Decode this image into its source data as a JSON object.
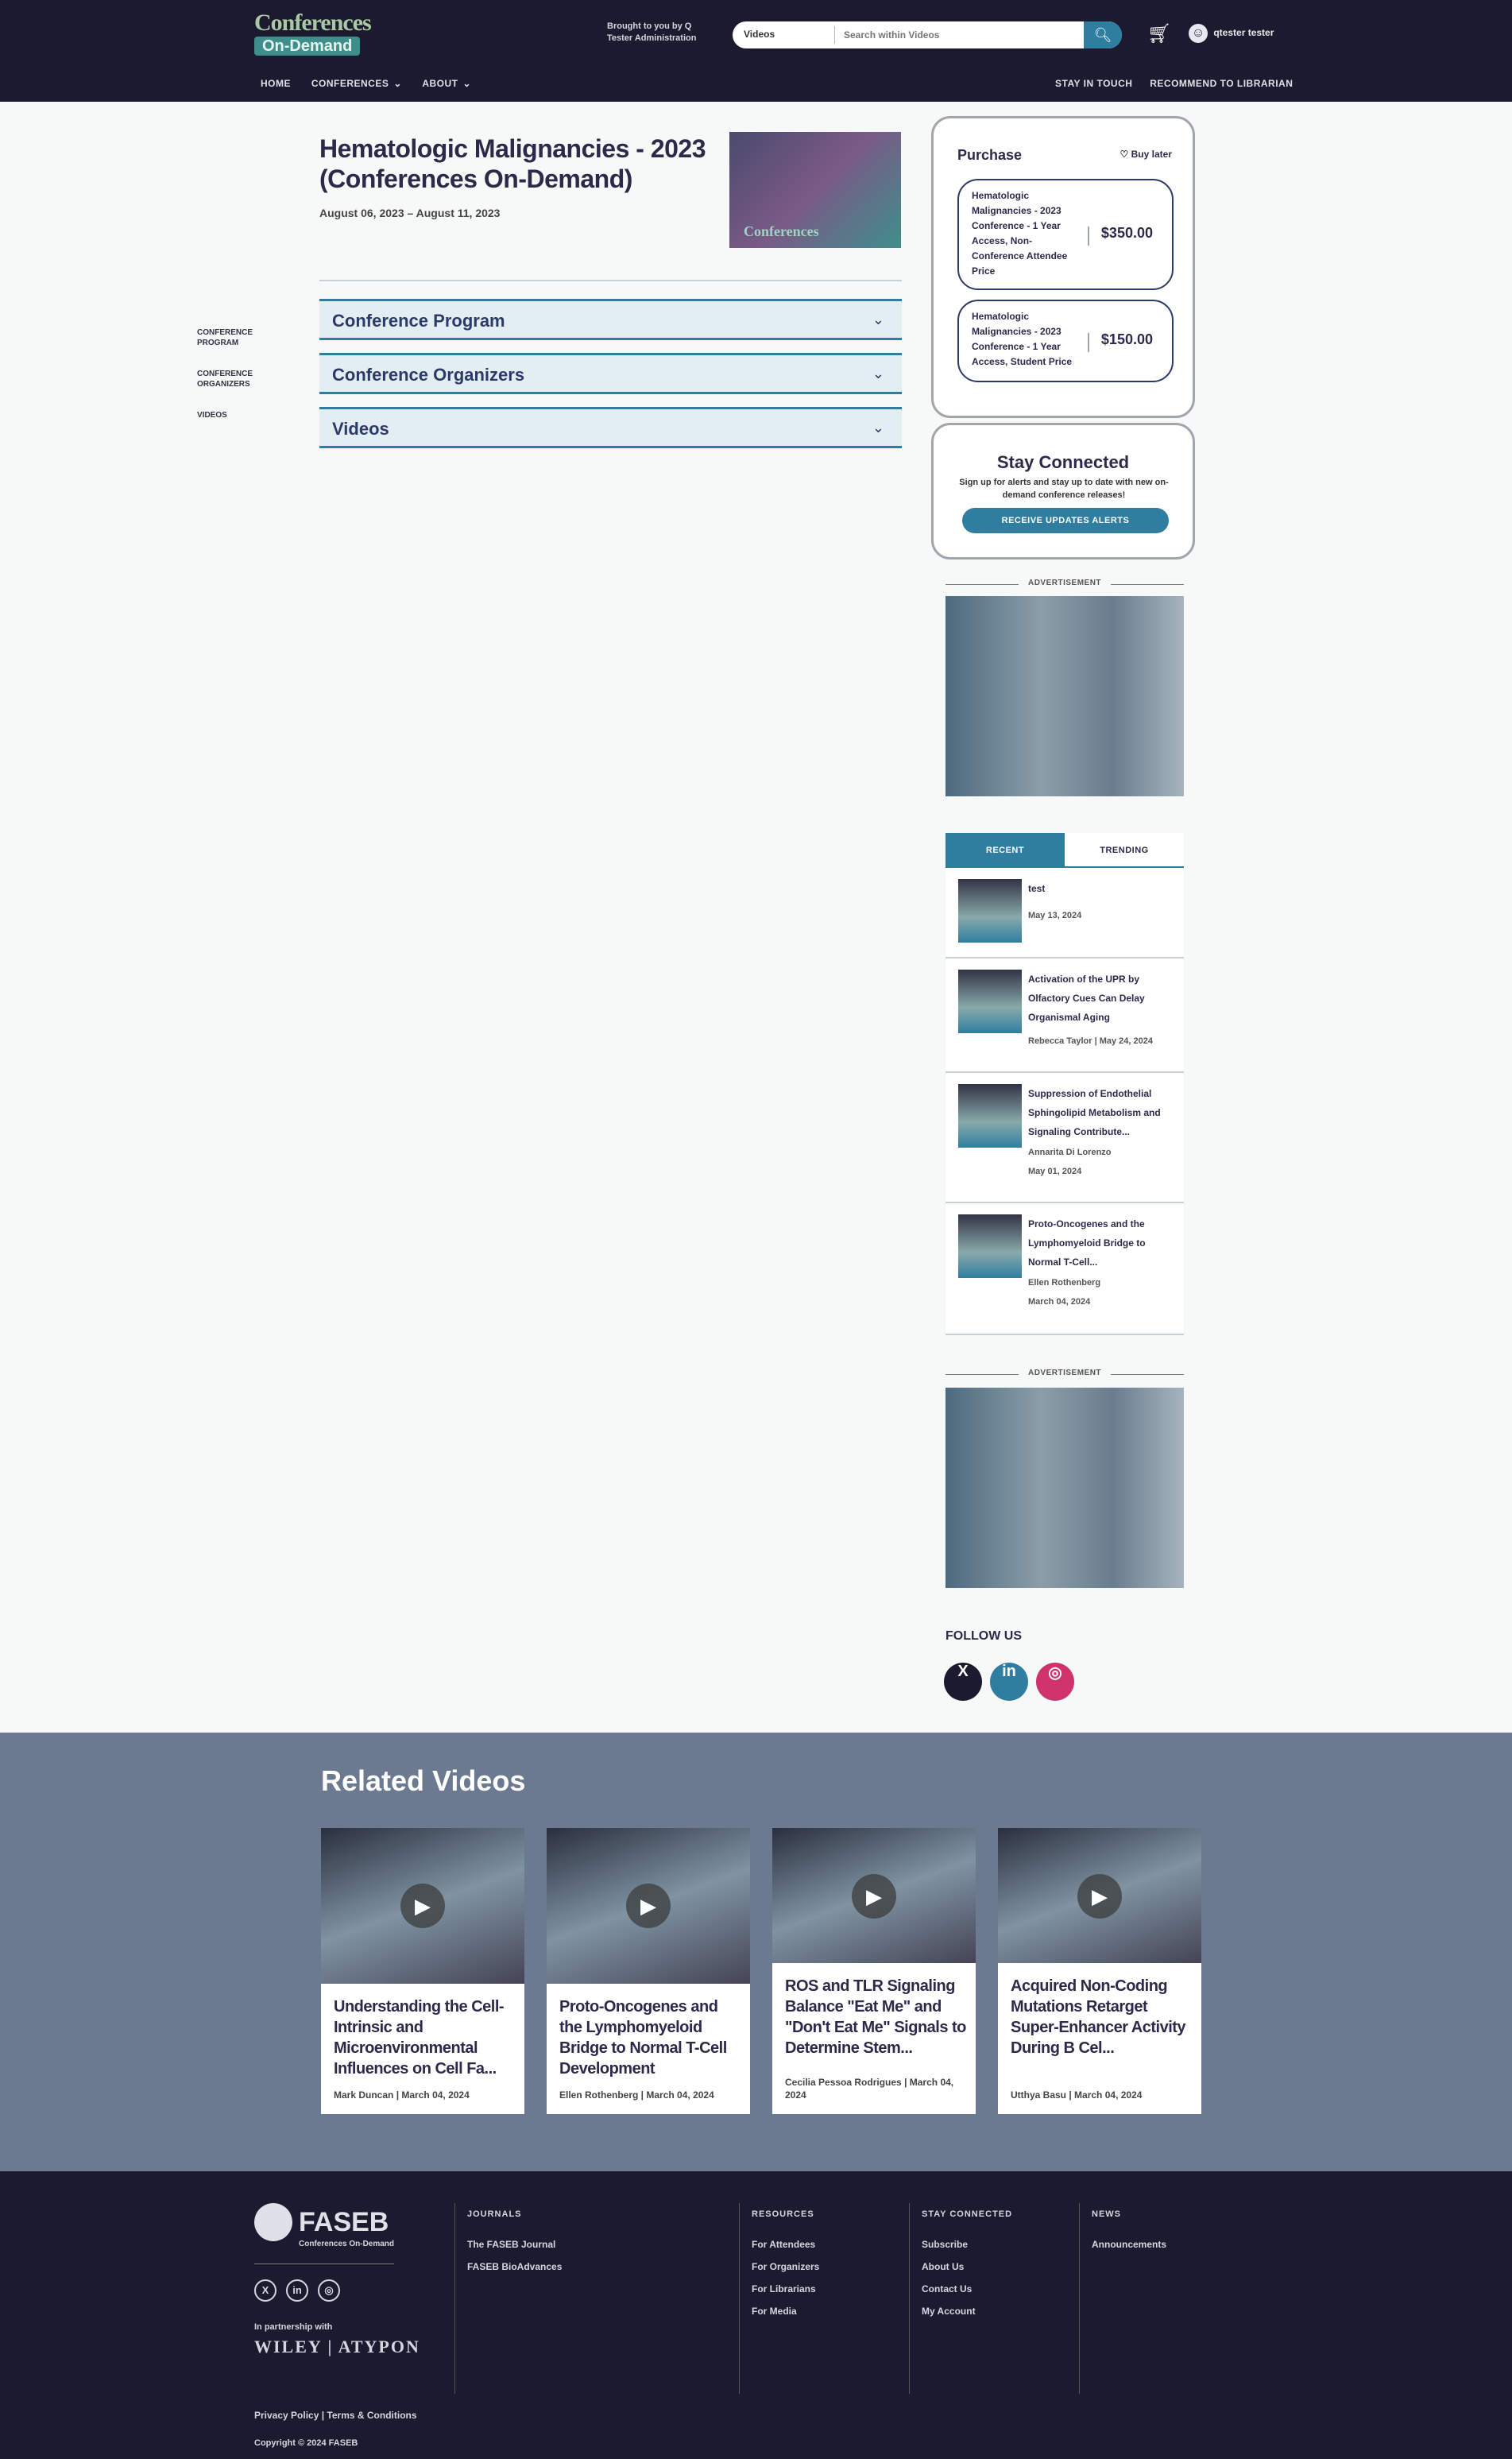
{
  "header": {
    "logo_line1": "Conferences",
    "logo_line2": "On-Demand",
    "brought_by": "Brought to you by Q Tester Administration",
    "search_scope": "Videos",
    "search_placeholder": "Search within Videos",
    "user_name": "qtester tester",
    "nav": [
      "HOME",
      "CONFERENCES",
      "ABOUT"
    ],
    "nav_right": [
      "STAY IN TOUCH",
      "RECOMMEND TO LIBRARIAN"
    ]
  },
  "main": {
    "title": "Hematologic Malignancies - 2023 (Conferences On-Demand)",
    "dates": "August 06, 2023 – August 11, 2023",
    "cover_text": "Conferences",
    "accordions": [
      "Conference Program",
      "Conference Organizers",
      "Videos"
    ],
    "side_nav": [
      "CONFERENCE PROGRAM",
      "CONFERENCE ORGANIZERS",
      "VIDEOS"
    ]
  },
  "purchase": {
    "heading": "Purchase",
    "buy_later": "Buy later",
    "options": [
      {
        "description": "Hematologic Malignancies - 2023 Conference - 1 Year Access, Non-Conference Attendee Price",
        "price": "$350.00"
      },
      {
        "description": "Hematologic Malignancies - 2023 Conference - 1 Year Access, Student Price",
        "price": "$150.00"
      }
    ]
  },
  "stay_connected": {
    "heading": "Stay Connected",
    "description": "Sign up for alerts and stay up to date with new on-demand conference releases!",
    "button": "RECEIVE UPDATES ALERTS"
  },
  "ad_label": "ADVERTISEMENT",
  "tabs": [
    "RECENT",
    "TRENDING"
  ],
  "recent_videos": [
    {
      "title": "test",
      "author": "",
      "date": "May 13, 2024"
    },
    {
      "title": "Activation of the UPR by Olfactory Cues Can Delay Organismal Aging",
      "author": "Rebecca Taylor",
      "date": "May 24, 2024"
    },
    {
      "title": "Suppression of Endothelial Sphingolipid Metabolism and Signaling Contribute...",
      "author": "Annarita Di Lorenzo",
      "date": "May 01, 2024"
    },
    {
      "title": "Proto-Oncogenes and the Lymphomyeloid Bridge to Normal T-Cell...",
      "author": "Ellen Rothenberg",
      "date": "March 04, 2024"
    }
  ],
  "follow_us": {
    "heading": "FOLLOW US",
    "icons": [
      "x-icon",
      "linkedin-icon",
      "instagram-icon"
    ],
    "colors": [
      "#1c1a2e",
      "#2f7ea0",
      "#d0336b"
    ]
  },
  "related": {
    "heading": "Related Videos",
    "cards": [
      {
        "title": "Understanding the Cell-Intrinsic and Microenvironmental Influences on Cell Fa...",
        "author": "Mark Duncan",
        "date": "March 04, 2024"
      },
      {
        "title": "Proto-Oncogenes and the Lymphomyeloid Bridge to Normal T-Cell Development",
        "author": "Ellen Rothenberg",
        "date": "March 04, 2024"
      },
      {
        "title": "ROS and TLR Signaling Balance \"Eat Me\" and \"Don't Eat Me\" Signals to Determine Stem...",
        "author": "Cecilia Pessoa Rodrigues",
        "date": "March 04, 2024"
      },
      {
        "title": "Acquired Non-Coding Mutations Retarget Super-Enhancer Activity During B Cel...",
        "author": "Utthya Basu",
        "date": "March 04, 2024"
      }
    ]
  },
  "footer": {
    "logo_name": "FASEB",
    "logo_sub": "Conferences On-Demand",
    "partnership": "In partnership with",
    "partner_name": "WILEY | ATYPON",
    "columns": [
      {
        "heading": "JOURNALS",
        "links": [
          "The FASEB Journal",
          "FASEB BioAdvances"
        ]
      },
      {
        "heading": "RESOURCES",
        "links": [
          "For Attendees",
          "For Organizers",
          "For Librarians",
          "For Media"
        ]
      },
      {
        "heading": "STAY CONNECTED",
        "links": [
          "Subscribe",
          "About Us",
          "Contact Us",
          "My Account"
        ]
      },
      {
        "heading": "NEWS",
        "links": [
          "Announcements"
        ]
      }
    ],
    "privacy": "Privacy Policy",
    "terms": "Terms & Conditions",
    "copyright": "Copyright © 2024 FASEB"
  },
  "colors": {
    "header_bg": "#1c1a2e",
    "accent": "#2f7ea0",
    "related_bg": "#6c7a91"
  }
}
